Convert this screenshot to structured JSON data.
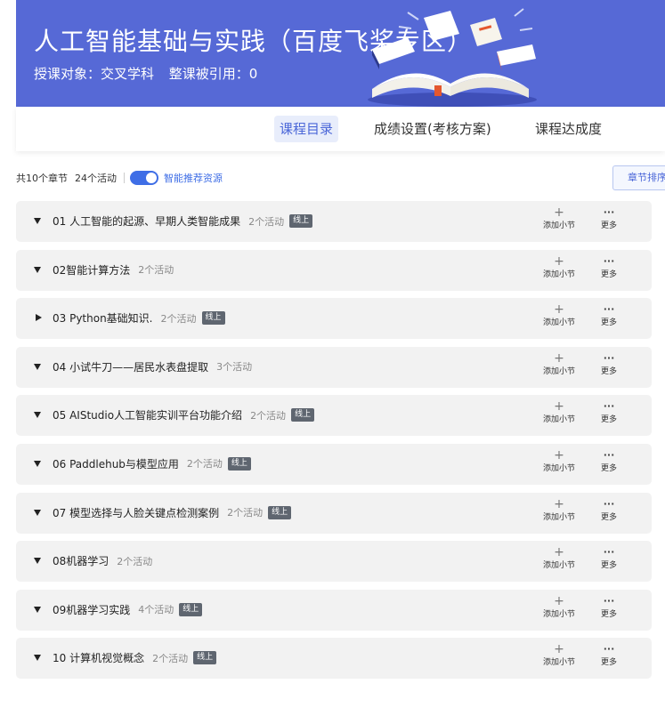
{
  "banner": {
    "title": "人工智能基础与实践（百度飞桨专区）",
    "audience": "授课对象：交叉学科",
    "citations": "整课被引用：0",
    "colors": {
      "background": "#5669d6"
    }
  },
  "tabs": [
    {
      "label": "课程目录",
      "active": true
    },
    {
      "label": "成绩设置(考核方案)",
      "active": false
    },
    {
      "label": "课程达成度",
      "active": false
    }
  ],
  "summary": {
    "chapters": "共10个章节",
    "activities": "24个活动",
    "toggle_label": "智能推荐资源",
    "toggle_on": true
  },
  "sort_button": "章节排序",
  "actions": {
    "add_label": "添加小节",
    "more_label": "更多",
    "add_icon": "plus-icon",
    "more_icon": "ellipsis-icon"
  },
  "chapters": [
    {
      "title": "01 人工智能的起源、早期人类智能成果",
      "count": "2个活动",
      "badge": "线上",
      "expanded": true
    },
    {
      "title": "02智能计算方法",
      "count": "2个活动",
      "badge": "",
      "expanded": true
    },
    {
      "title": "03 Python基础知识.",
      "count": "2个活动",
      "badge": "线上",
      "expanded": false
    },
    {
      "title": "04 小试牛刀——居民水表盘提取",
      "count": "3个活动",
      "badge": "",
      "expanded": true
    },
    {
      "title": "05 AIStudio人工智能实训平台功能介绍",
      "count": "2个活动",
      "badge": "线上",
      "expanded": true
    },
    {
      "title": "06 Paddlehub与模型应用",
      "count": "2个活动",
      "badge": "线上",
      "expanded": true
    },
    {
      "title": "07 模型选择与人脸关键点检测案例",
      "count": "2个活动",
      "badge": "线上",
      "expanded": true
    },
    {
      "title": "08机器学习",
      "count": "2个活动",
      "badge": "",
      "expanded": true
    },
    {
      "title": "09机器学习实践",
      "count": "4个活动",
      "badge": "线上",
      "expanded": true
    },
    {
      "title": "10 计算机视觉概念",
      "count": "2个活动",
      "badge": "线上",
      "expanded": true
    }
  ]
}
